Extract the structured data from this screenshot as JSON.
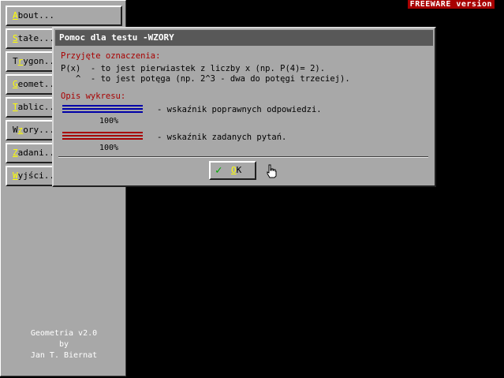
{
  "banner": "FREEWARE version",
  "sidebar": {
    "items": [
      {
        "hotkey": "A",
        "rest": "bout..."
      },
      {
        "hotkey": "S",
        "rest": "tałe..."
      },
      {
        "pre": "T",
        "hotkey": "r",
        "rest": "ygon..."
      },
      {
        "hotkey": "G",
        "rest": "eomet..."
      },
      {
        "hotkey": "T",
        "rest": "ablic..."
      },
      {
        "pre": "W",
        "hotkey": "z",
        "rest": "ory..."
      },
      {
        "hotkey": "Z",
        "rest": "adani..."
      },
      {
        "hotkey": "W",
        "rest": "yjści..."
      }
    ],
    "credits": [
      "Geometria v2.0",
      "by",
      "Jan T. Biernat"
    ]
  },
  "dialog": {
    "title": "Pomoc dla testu -WZORY",
    "notation_heading": "Przyjęte oznaczenia:",
    "line1": "P(x)  - to jest pierwiastek z liczby x (np. P(4)= 2).",
    "line2": "   ^  - to jest potęga (np. 2^3 - dwa do potęgi trzeciej).",
    "chart_heading": "Opis wykresu:",
    "blue_desc": "- wskaźnik poprawnych odpowiedzi.",
    "blue_pct": "100%",
    "red_desc": "- wskaźnik zadanych pytań.",
    "red_pct": "100%",
    "ok_hotkey": "O",
    "ok_rest": "K",
    "colors": {
      "blue": "#0000a8",
      "red": "#a80000"
    }
  }
}
